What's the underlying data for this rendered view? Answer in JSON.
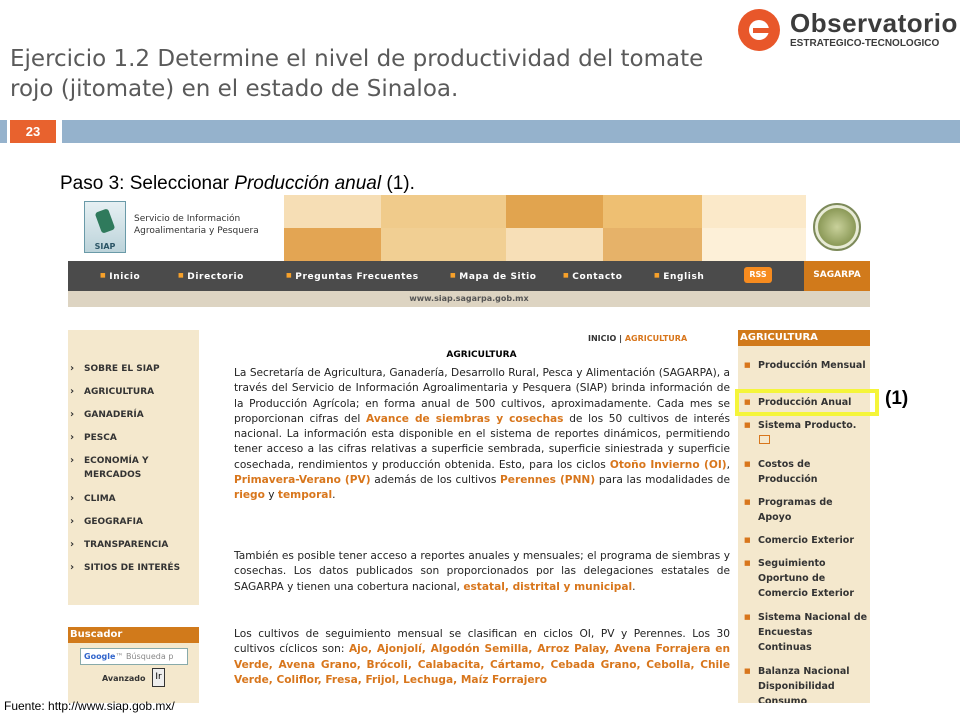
{
  "slide": {
    "title": "Ejercicio 1.2 Determine el nivel de productividad del tomate rojo (jitomate) en el estado de Sinaloa.",
    "number": "23",
    "step_prefix": "Paso 3: Seleccionar ",
    "step_italic": "Producción anual",
    "step_suffix": " (1).",
    "source": "Fuente: http://www.siap.gob.mx/",
    "callout": "(1)"
  },
  "logo": {
    "name": "Observatorio",
    "subtitle": "ESTRATEGICO-TECNOLOGICO"
  },
  "site": {
    "logo_text": "SIAP",
    "name_line1": "Servicio de Información",
    "name_line2": "Agroalimentaria y Pesquera",
    "nav": [
      "Inicio",
      "Directorio",
      "Preguntas Frecuentes",
      "Mapa de Sitio",
      "Contacto",
      "English"
    ],
    "rss": "RSS",
    "sagarpa": "SAGARPA",
    "url": "www.siap.sagarpa.gob.mx",
    "left_menu": [
      "SOBRE EL SIAP",
      "AGRICULTURA",
      "GANADERÍA",
      "PESCA",
      "ECONOMÍA Y MERCADOS",
      "CLIMA",
      "GEOGRAFIA",
      "TRANSPARENCIA",
      "SITIOS DE INTERÉS"
    ],
    "buscador": {
      "header": "Buscador",
      "brand": "Google",
      "placeholder": "Búsqueda p",
      "advanced": "Avanzado",
      "go": "Ir"
    },
    "breadcrumb": {
      "home": "INICIO",
      "separator": "|",
      "current": "AGRICULTURA"
    },
    "content_title": "AGRICULTURA",
    "p1": {
      "a": "La Secretaría de Agricultura, Ganadería, Desarrollo Rural, Pesca y Alimentación (SAGARPA), a través del Servicio de Información Agroalimentaria y Pesquera (SIAP) brinda información de la Producción Agrícola; en forma anual de 500 cultivos, aproximadamente. Cada mes se proporcionan cifras del ",
      "l1": "Avance de siembras y cosechas",
      "b": " de los 50 cultivos de interés nacional. La información esta disponible en el sistema de reportes dinámicos, permitiendo tener acceso a las cifras relativas a superficie sembrada, superficie siniestrada y superficie cosechada, rendimientos y producción obtenida. Esto, para los ciclos ",
      "l2": "Otoño Invierno (OI)",
      "c": ", ",
      "l3": "Primavera-Verano (PV)",
      "d": " además de los cultivos ",
      "l4": "Perennes (PNN)",
      "e": " para las modalidades de ",
      "l5": "riego",
      "f": " y ",
      "l6": "temporal",
      "g": "."
    },
    "p2": {
      "a": "También es posible tener acceso a reportes anuales y mensuales; el programa de siembras y cosechas. Los datos publicados son proporcionados por las delegaciones estatales de SAGARPA y tienen una cobertura nacional, ",
      "l1": "estatal, distrital y municipal",
      "b": "."
    },
    "p3": {
      "a": "Los cultivos de seguimiento mensual se clasifican en ciclos OI, PV y Perennes. Los 30 cultivos cíclicos son: ",
      "crops": "Ajo, Ajonjolí, Algodón Semilla, Arroz Palay, Avena Forrajera en Verde, Avena Grano, Brócoli, Calabacita, Cártamo, Cebada Grano, Cebolla, Chile Verde, Coliflor, Fresa, Frijol, Lechuga, Maíz Forrajero"
    },
    "right_menu": {
      "header": "AGRICULTURA",
      "items": [
        "Producción Mensual",
        "Producción Anual",
        "Sistema Producto.",
        "Costos de Producción",
        "Programas de Apoyo",
        "Comercio Exterior",
        "Seguimiento Oportuno de Comercio Exterior",
        "Sistema Nacional de Encuestas Continuas",
        "Balanza Nacional Disponibilidad Consumo"
      ]
    }
  },
  "colors": {
    "accent_orange": "#e8622e",
    "bar_blue": "#95b2cc",
    "site_orange": "#d17a1b",
    "highlight_yellow": "#f5f53a"
  }
}
